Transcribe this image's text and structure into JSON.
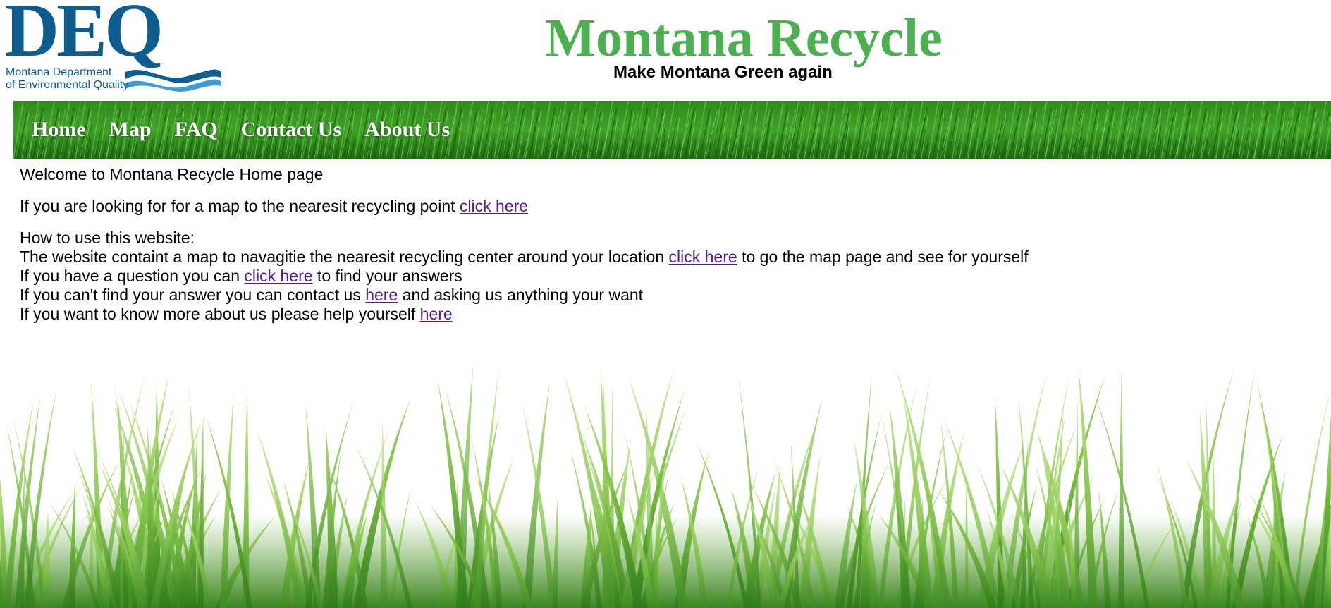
{
  "logo": {
    "letters": "DEQ",
    "line1": "Montana Department",
    "line2": "of Environmental Quality"
  },
  "header": {
    "title": "Montana Recycle",
    "tagline": "Make Montana Green again"
  },
  "nav": {
    "items": [
      {
        "label": "Home"
      },
      {
        "label": "Map"
      },
      {
        "label": "FAQ"
      },
      {
        "label": "Contact Us"
      },
      {
        "label": "About Us"
      }
    ]
  },
  "content": {
    "welcome": "Welcome to Montana Recycle Home page",
    "map_line": {
      "text": "If you are looking for for a map to the nearesit recycling point ",
      "link": "click here"
    },
    "howto_heading": "How to use this website:",
    "line1": {
      "before": "The website containt a map to navagitie the nearesit recycling center around your location ",
      "link": "click here",
      "after": " to go the map page and see for yourself"
    },
    "line2": {
      "before": "If you have a question you can ",
      "link": "click here",
      "after": " to find your answers"
    },
    "line3": {
      "before": "If you can't find your answer you can contact us ",
      "link": "here",
      "after": " and asking us anything your want"
    },
    "line4": {
      "before": "If you want to know more about us please help yourself ",
      "link": "here"
    }
  },
  "colors": {
    "logo_blue": "#0f5c91",
    "logo_wave": "#3f9bd6",
    "title_green": "#4caf50",
    "link_visited": "#551a8b",
    "grass_dark": "#1f6e12",
    "grass_light": "#7fbf3e"
  }
}
